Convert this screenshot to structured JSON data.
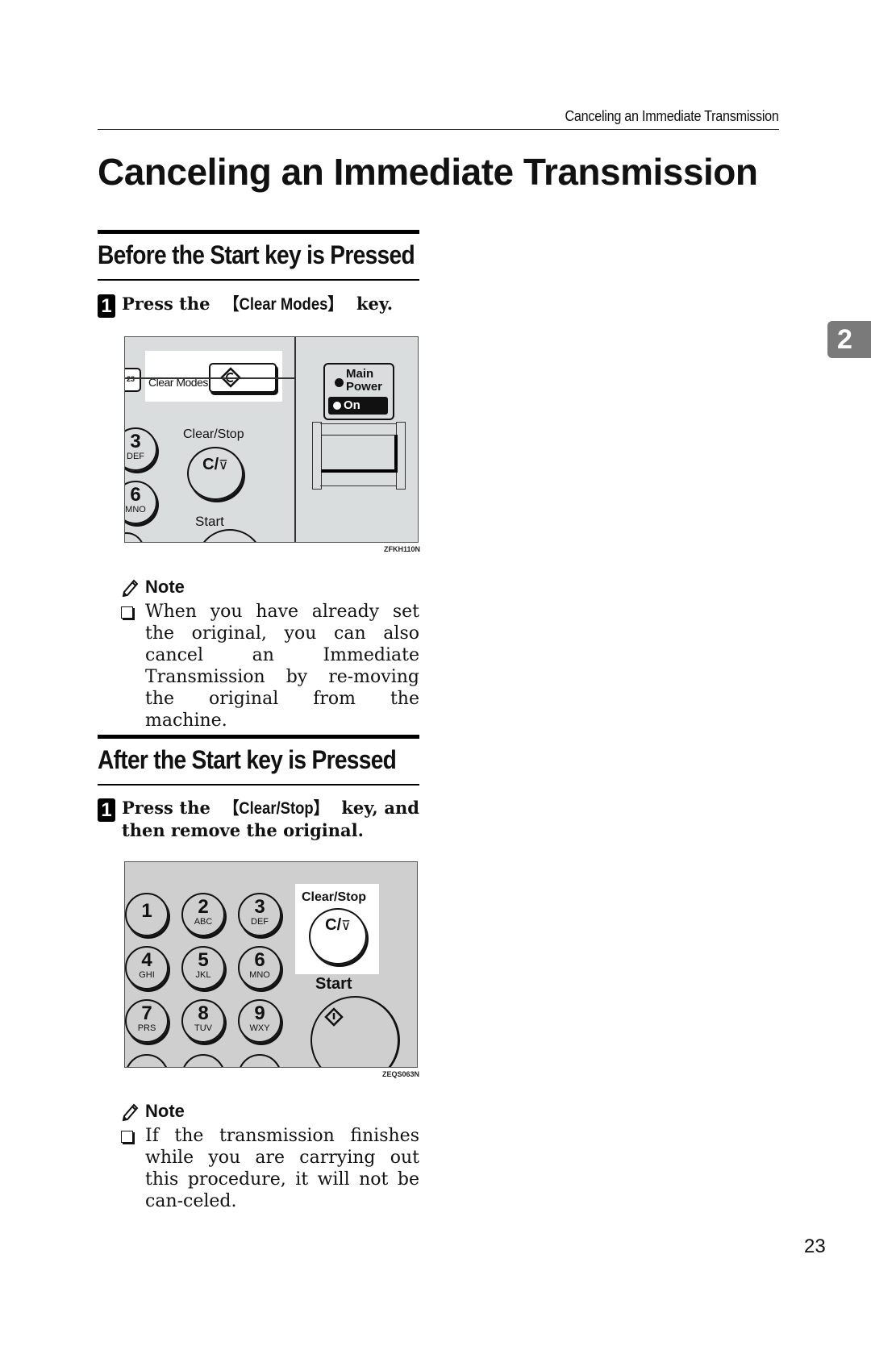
{
  "header": {
    "running_title": "Canceling an Immediate Transmission"
  },
  "title": "Canceling an Immediate Transmission",
  "chapter_tab": "2",
  "page_number": "23",
  "sections": [
    {
      "heading": "Before the Start key is Pressed",
      "step": {
        "number": "1",
        "prefix": "Press the ",
        "key_open": "【",
        "key": "Clear Modes",
        "key_close": "】",
        "suffix": " key."
      },
      "figure": {
        "code": "ZFKH110N",
        "labels": {
          "clear_modes": "Clear Modes",
          "clear_stop": "Clear/Stop",
          "clear_stop_glyph": "C/",
          "start": "Start",
          "main_power_1": "Main",
          "main_power_2": "Power",
          "on": "On",
          "key3": "3",
          "key3_sub": "DEF",
          "key6": "6",
          "key6_sub": "MNO",
          "tab_small": "23"
        }
      },
      "note": {
        "heading": "Note",
        "items": [
          "When you have already set the original, you can also cancel an Immediate Transmission by re-moving the original from the machine."
        ]
      }
    },
    {
      "heading": "After the Start key is Pressed",
      "step": {
        "number": "1",
        "prefix": "Press the ",
        "key_open": "【",
        "key": "Clear/Stop",
        "key_close": "】",
        "suffix": " key, and then remove the original."
      },
      "figure": {
        "code": "ZEQS063N",
        "labels": {
          "clear_stop": "Clear/Stop",
          "clear_stop_glyph": "C/",
          "start": "Start"
        },
        "keypad": [
          {
            "n": "1",
            "l": ""
          },
          {
            "n": "2",
            "l": "ABC"
          },
          {
            "n": "3",
            "l": "DEF"
          },
          {
            "n": "4",
            "l": "GHI"
          },
          {
            "n": "5",
            "l": "JKL"
          },
          {
            "n": "6",
            "l": "MNO"
          },
          {
            "n": "7",
            "l": "PRS"
          },
          {
            "n": "8",
            "l": "TUV"
          },
          {
            "n": "9",
            "l": "WXY"
          }
        ]
      },
      "note": {
        "heading": "Note",
        "items": [
          "If the transmission finishes while you are carrying out this procedure, it will not be can-celed."
        ]
      }
    }
  ]
}
